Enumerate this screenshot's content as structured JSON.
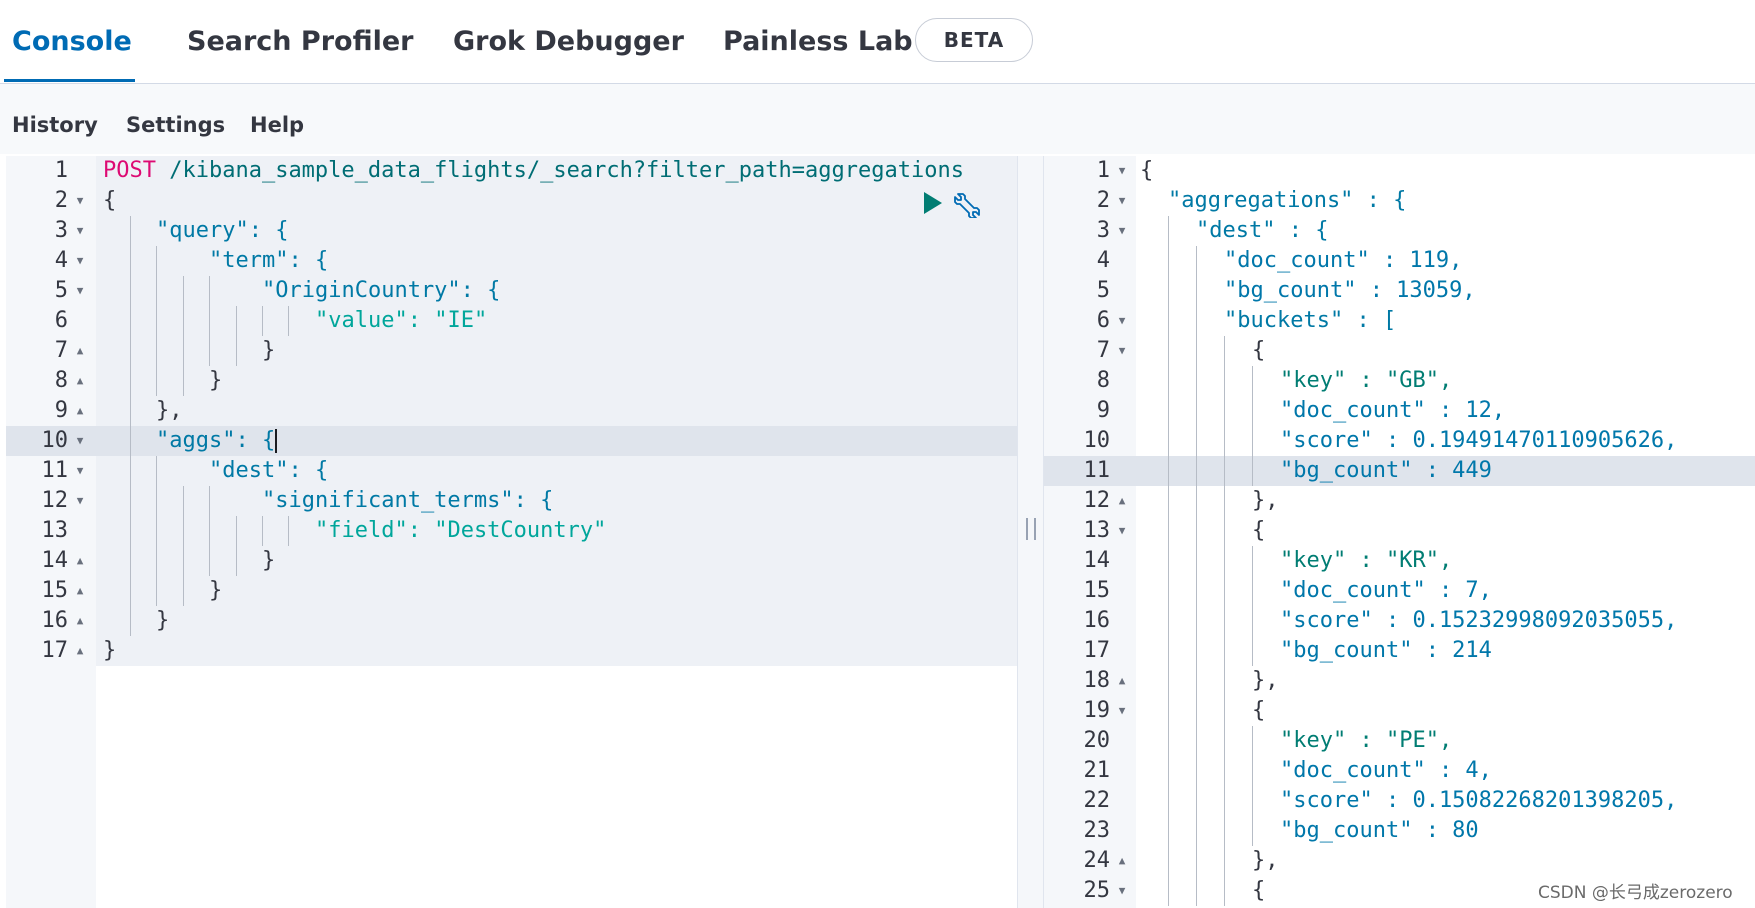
{
  "tabs": [
    {
      "label": "Console",
      "active": true
    },
    {
      "label": "Search Profiler",
      "active": false
    },
    {
      "label": "Grok Debugger",
      "active": false
    },
    {
      "label": "Painless Lab",
      "active": false
    }
  ],
  "beta_badge": "BETA",
  "menu": {
    "history": "History",
    "settings": "Settings",
    "help": "Help"
  },
  "request": {
    "method": "POST",
    "path": "/kibana_sample_data_flights/_search?filter_path=aggregations",
    "lines": [
      "{",
      "\"query\": {",
      "\"term\": {",
      "\"OriginCountry\": {",
      "\"value\": \"IE\"",
      "}",
      "}",
      "},",
      "\"aggs\": {",
      "\"dest\": {",
      "\"significant_terms\": {",
      "\"field\": \"DestCountry\"",
      "}",
      "}",
      "}",
      "}"
    ]
  },
  "response": {
    "lines": [
      "{",
      "\"aggregations\" : {",
      "\"dest\" : {",
      "\"doc_count\" : 119,",
      "\"bg_count\" : 13059,",
      "\"buckets\" : [",
      "{",
      "\"key\" : \"GB\",",
      "\"doc_count\" : 12,",
      "\"score\" : 0.19491470110905626,",
      "\"bg_count\" : 449",
      "},",
      "{",
      "\"key\" : \"KR\",",
      "\"doc_count\" : 7,",
      "\"score\" : 0.15232998092035055,",
      "\"bg_count\" : 214",
      "},",
      "{",
      "\"key\" : \"PE\",",
      "\"doc_count\" : 4,",
      "\"score\" : 0.15082268201398205,",
      "\"bg_count\" : 80",
      "},",
      "{"
    ]
  },
  "watermark": "CSDN @长弓成zerozero",
  "colors": {
    "accent": "#006bb4",
    "method": "#dd0a73",
    "string": "#00a69b",
    "key": "#0079a5"
  },
  "icons": [
    "play-icon",
    "wrench-icon",
    "fold-arrow-icon",
    "resize-grip-icon"
  ]
}
